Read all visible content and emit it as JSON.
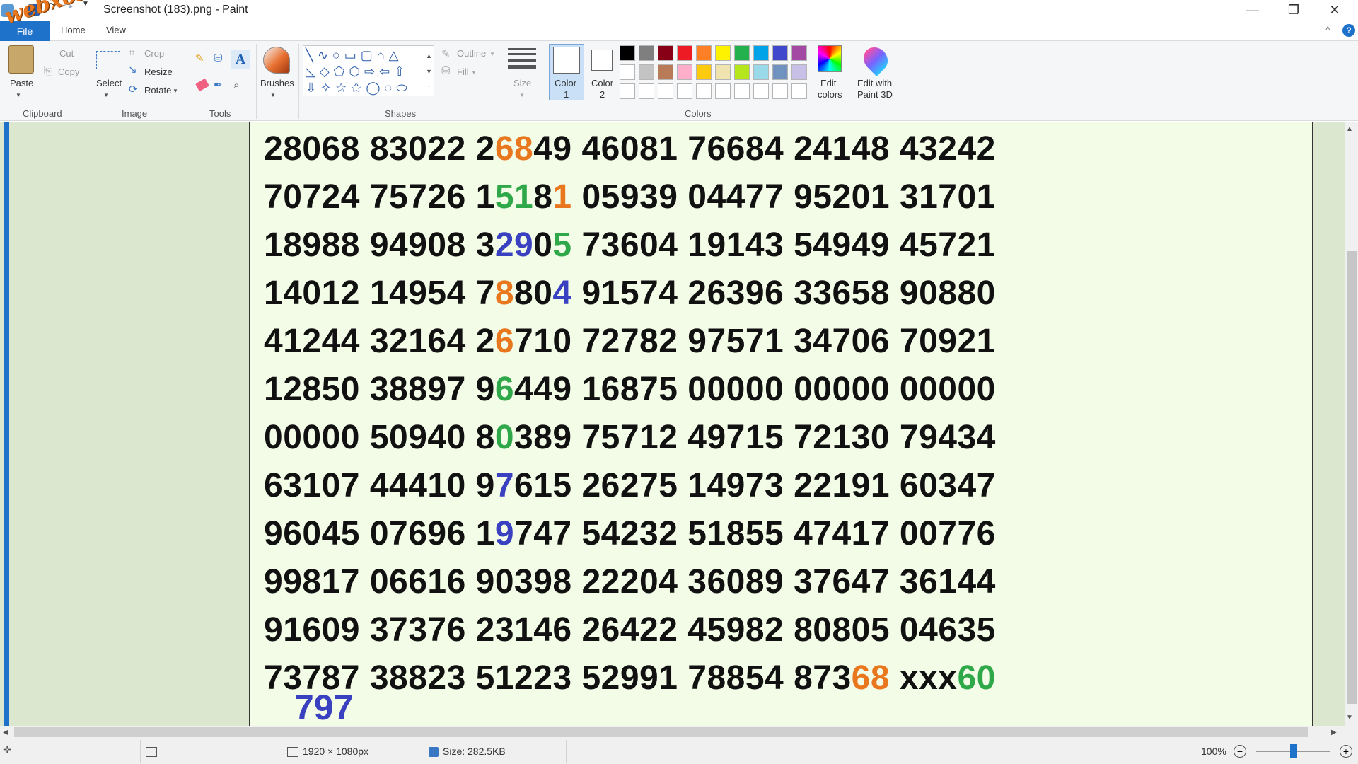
{
  "window": {
    "title": "Screenshot (183).png - Paint",
    "minimize_icon": "—",
    "maximize_icon": "❐",
    "close_icon": "✕"
  },
  "quick_access": {
    "save_icon": "save-icon",
    "undo_icon": "undo-icon",
    "redo_icon": "redo-icon"
  },
  "tabs": {
    "file": "File",
    "home": "Home",
    "view": "View"
  },
  "watermark": "webxoso.net",
  "ribbon": {
    "clipboard": {
      "paste": "Paste",
      "cut": "Cut",
      "copy": "Copy",
      "label": "Clipboard"
    },
    "image": {
      "select": "Select",
      "crop": "Crop",
      "resize": "Resize",
      "rotate": "Rotate",
      "label": "Image"
    },
    "tools": {
      "label": "Tools"
    },
    "brushes": {
      "label": "Brushes"
    },
    "shapes": {
      "outline": "Outline",
      "fill": "Fill",
      "label": "Shapes"
    },
    "size": {
      "label": "Size"
    },
    "colors": {
      "color1": "Color",
      "color1_num": "1",
      "color2": "Color",
      "color2_num": "2",
      "edit_colors_1": "Edit",
      "edit_colors_2": "colors",
      "paint3d_1": "Edit with",
      "paint3d_2": "Paint 3D",
      "label": "Colors",
      "palette_row1": [
        "#000000",
        "#7f7f7f",
        "#880015",
        "#ed1c24",
        "#ff7f27",
        "#fff200",
        "#22b14c",
        "#00a2e8",
        "#3f48cc",
        "#a349a4"
      ],
      "palette_row2": [
        "#ffffff",
        "#c3c3c3",
        "#b97a57",
        "#ffaec9",
        "#ffc90e",
        "#efe4b0",
        "#b5e61d",
        "#99d9ea",
        "#7092be",
        "#c8bfe7"
      ]
    }
  },
  "canvas_rows": [
    [
      {
        "t": "28068 83022 2"
      },
      {
        "t": "68",
        "c": "o"
      },
      {
        "t": "49 46081 76684 24148 43242"
      }
    ],
    [
      {
        "t": "70724 75726 1"
      },
      {
        "t": "51",
        "c": "g"
      },
      {
        "t": "8"
      },
      {
        "t": "1",
        "c": "o"
      },
      {
        "t": " 05939 04477 95201 31701"
      }
    ],
    [
      {
        "t": "18988 94908 3"
      },
      {
        "t": "29",
        "c": "b"
      },
      {
        "t": "0"
      },
      {
        "t": "5",
        "c": "g"
      },
      {
        "t": " 73604 19143 54949 45721"
      }
    ],
    [
      {
        "t": "14012 14954 7"
      },
      {
        "t": "8",
        "c": "o"
      },
      {
        "t": "80"
      },
      {
        "t": "4",
        "c": "b"
      },
      {
        "t": " 91574 26396 33658 90880"
      }
    ],
    [
      {
        "t": "41244 32164 2"
      },
      {
        "t": "6",
        "c": "o"
      },
      {
        "t": "710 72782 97571 34706 70921"
      }
    ],
    [
      {
        "t": "12850 38897 9"
      },
      {
        "t": "6",
        "c": "g"
      },
      {
        "t": "449 16875 00000 00000 00000"
      }
    ],
    [
      {
        "t": "00000 50940 8"
      },
      {
        "t": "0",
        "c": "g"
      },
      {
        "t": "389 75712 49715 72130 79434"
      }
    ],
    [
      {
        "t": "63107 44410 9"
      },
      {
        "t": "7",
        "c": "b"
      },
      {
        "t": "615 26275 14973 22191 60347"
      }
    ],
    [
      {
        "t": "96045 07696 1"
      },
      {
        "t": "9",
        "c": "b"
      },
      {
        "t": "747 54232 51855 47417 00776"
      }
    ],
    [
      {
        "t": "99817 06616 90398 22204 36089 37647 36144"
      }
    ],
    [
      {
        "t": "91609 37376 23146 26422 45982 80805 04635"
      }
    ],
    [
      {
        "t": "73787 38823 51223 52991 78854 873"
      },
      {
        "t": "68",
        "c": "o"
      },
      {
        "t": " xxx"
      },
      {
        "t": "60",
        "c": "g"
      }
    ]
  ],
  "canvas_extra": "797",
  "status": {
    "dimensions": "1920 × 1080px",
    "size": "Size: 282.5KB",
    "zoom": "100%",
    "zoom_minus": "−",
    "zoom_plus": "+"
  }
}
